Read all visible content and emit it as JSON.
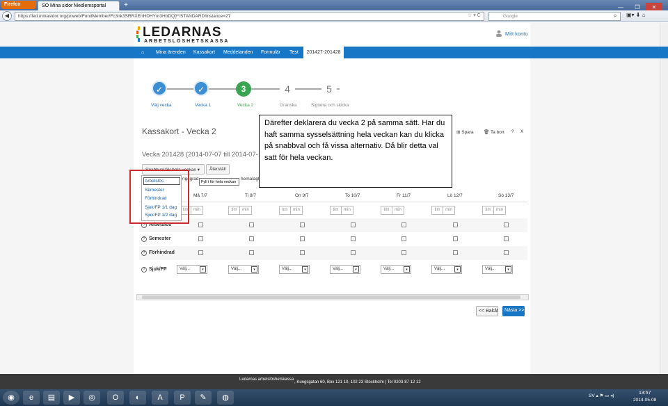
{
  "browser": {
    "menu_button": "Firefox",
    "tab_title": "SO Mina sidor Medlemsportal",
    "url": "https://led.minasidor.org/pnweb/FundMember/Fc3nk3SRRXEnHDHYm3HbDQ[!*!STANDARD!instance=27",
    "search_placeholder": "Google",
    "search_engine": "8"
  },
  "site": {
    "logo": "LEDARNAS",
    "logo_sub": "ARBETSLÖSHETSKASSA",
    "account_link": "Mitt konto"
  },
  "nav": {
    "items": [
      "Mina ärenden",
      "Kassakort",
      "Meddelanden",
      "Formulär",
      "Test"
    ],
    "active": "201427-201428"
  },
  "steps": [
    {
      "symbol": "✓",
      "label": "Välj vecka"
    },
    {
      "symbol": "✓",
      "label": "Vecka 1"
    },
    {
      "symbol": "3",
      "label": "Vecka 2"
    },
    {
      "symbol": "4",
      "label": "Granska"
    },
    {
      "symbol": "5",
      "label": "Signera och skicka"
    }
  ],
  "page_title": "Kassakort - Vecka 2",
  "week_title": "Vecka 201428 (2014-07-07 till 2014-07-13)",
  "toolbar": {
    "save": "Spara",
    "remove": "Ta bort",
    "help": "?",
    "close": "X"
  },
  "tooltip_text": "Därefter deklarera du vecka 2 på samma sätt. Har du haft samma sysselsättning hela veckan kan du klicka på snabbval och få vissa alternativ. Då blir detta val satt för hela veckan.",
  "controls": {
    "snabbval": "Snabbval för hela veckan ▾",
    "reset": "Återställ",
    "partial1": "ngsgrad",
    "fill_tip": "Fyll i för hela veckan",
    "partial2": "hemalagt"
  },
  "dropdown_options": [
    "Arbetslös",
    "Semester",
    "Förhindrad",
    "Sjuk/FP 1/1 dag",
    "Sjuk/FP 1/2 dag"
  ],
  "days": [
    "Må 7/7",
    "Ti 8/7",
    "On 9/7",
    "To 10/7",
    "Fr 11/7",
    "Lö 12/7",
    "Sö 13/7"
  ],
  "time_labels": {
    "hours": "tim",
    "minutes": "min"
  },
  "rows": [
    "Arbetslös",
    "Semester",
    "Förhindrad"
  ],
  "sick_row": {
    "label": "Sjuk/FP",
    "select": "Välj..."
  },
  "buttons": {
    "back": "<< Bakåt",
    "next": "Nästa >>"
  },
  "footer": {
    "org": "Ledarnas arbetslöshetskassa",
    "address": ", Kungsgatan 60, Box 121 10, 102 23 Stockholm | Tel 0203-87 12 12"
  },
  "taskbar": {
    "lang": "SV",
    "time": "13:57",
    "date": "2014-05-08"
  },
  "colors": {
    "accent": "#1876c6",
    "current_step": "#3ba453",
    "highlight": "#cc2b2b"
  }
}
